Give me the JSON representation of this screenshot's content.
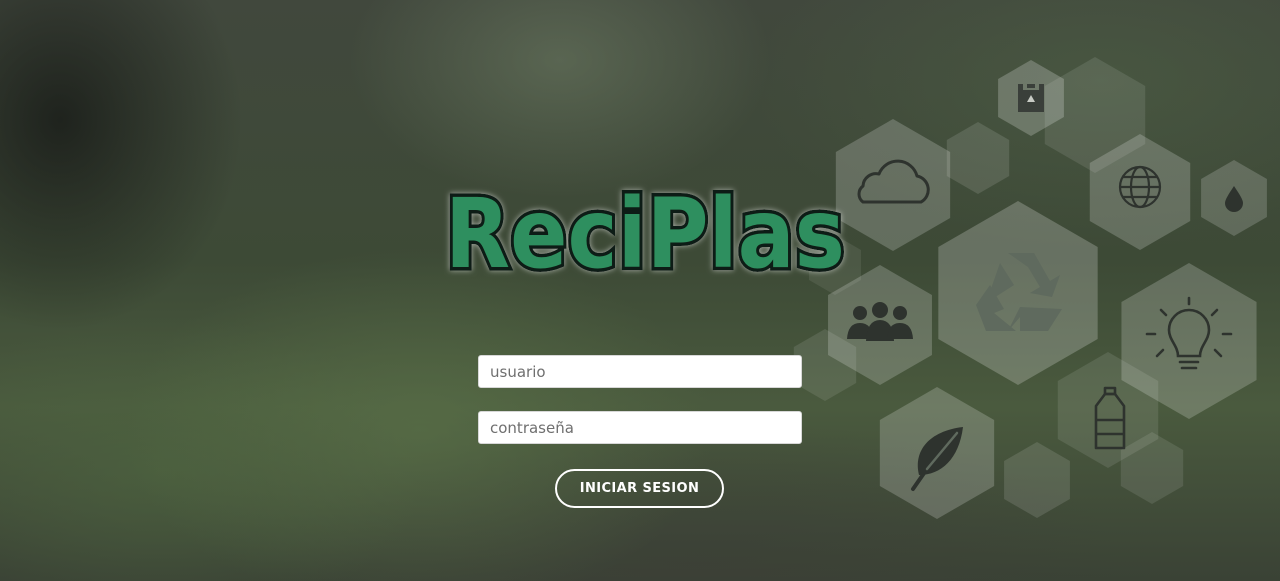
{
  "brand": {
    "logo_text": "ReciPlas",
    "colors": {
      "logo_fill": "#2f8f5f",
      "logo_outline": "#0d1a12",
      "accent": "#ffffff"
    }
  },
  "login": {
    "username_placeholder": "usuario",
    "password_placeholder": "contraseña",
    "submit_label": "INICIAR SESION"
  },
  "decor_icons": [
    "bag-icon",
    "cloud-icon",
    "globe-icon",
    "droplet-icon",
    "recycle-icon",
    "people-icon",
    "lightbulb-icon",
    "bottle-icon",
    "leaf-icon"
  ]
}
